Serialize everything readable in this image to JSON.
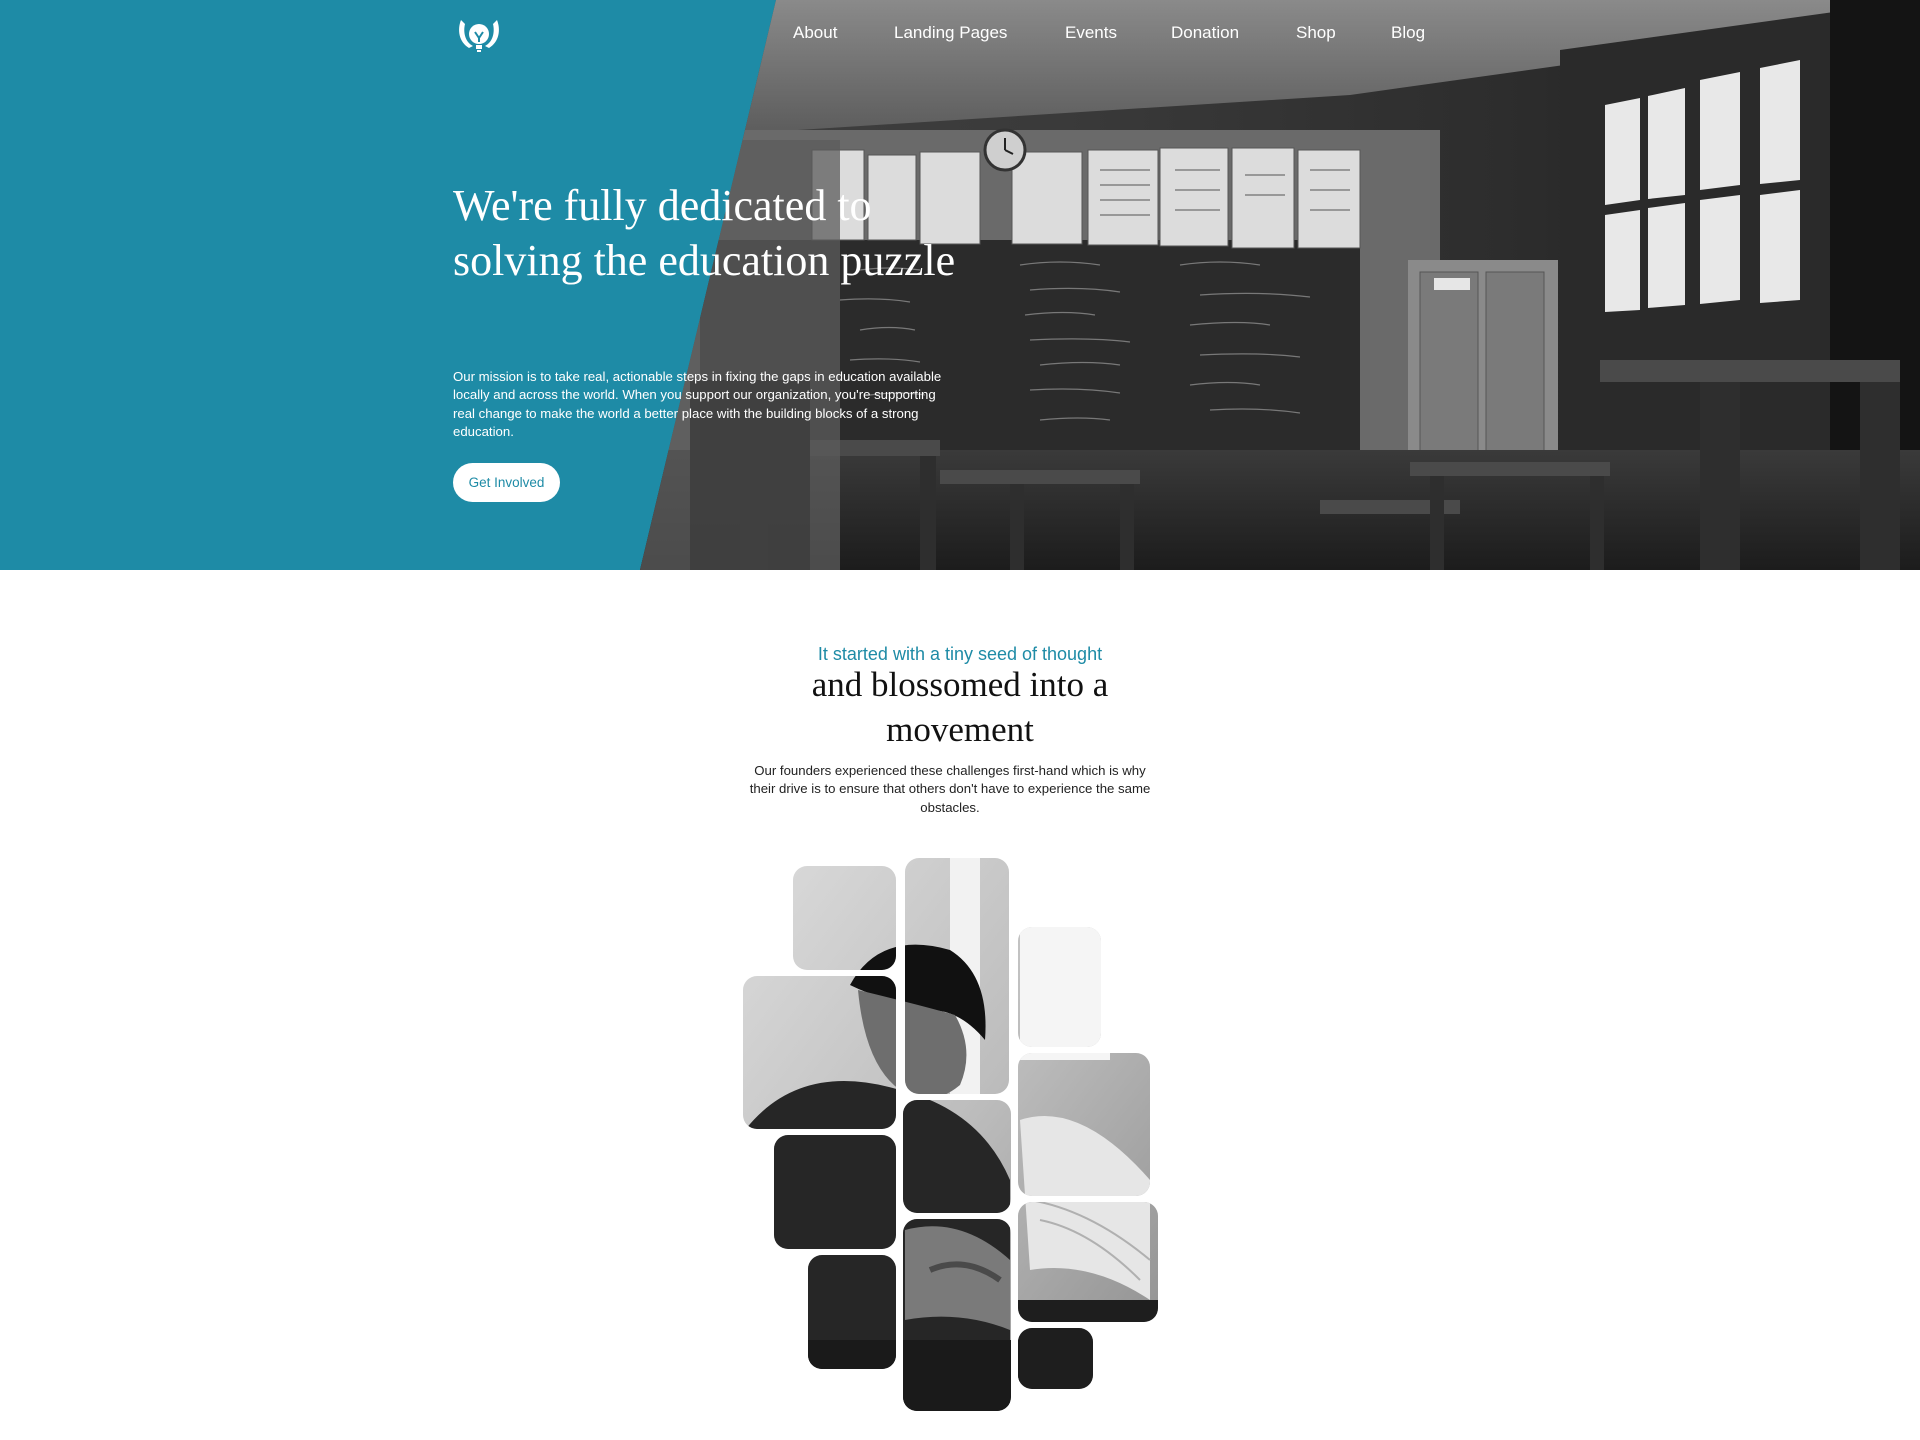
{
  "nav": {
    "items": [
      {
        "label": "About"
      },
      {
        "label": "Landing Pages"
      },
      {
        "label": "Events"
      },
      {
        "label": "Donation"
      },
      {
        "label": "Shop"
      },
      {
        "label": "Blog"
      }
    ]
  },
  "hero": {
    "title": "We're fully dedicated to solving the education puzzle",
    "description": "Our mission is to take real, actionable steps in fixing the gaps in education available locally and across the world. When you support our organization, you're supporting real change to make the world a better place with the building blocks of a strong education.",
    "cta_label": "Get Involved",
    "accent_color": "#1e8ba6",
    "photo": "classroom-photo"
  },
  "about": {
    "eyebrow": "It started with a tiny seed of thought",
    "title": "and blossomed into a movement",
    "description": "Our founders experienced these challenges first-hand which is why their drive is to ensure that others don't have to experience the same obstacles.",
    "mosaic_image": "student-reading-mosaic"
  },
  "icons": {
    "logo": "hands-lightbulb-logo-icon"
  }
}
